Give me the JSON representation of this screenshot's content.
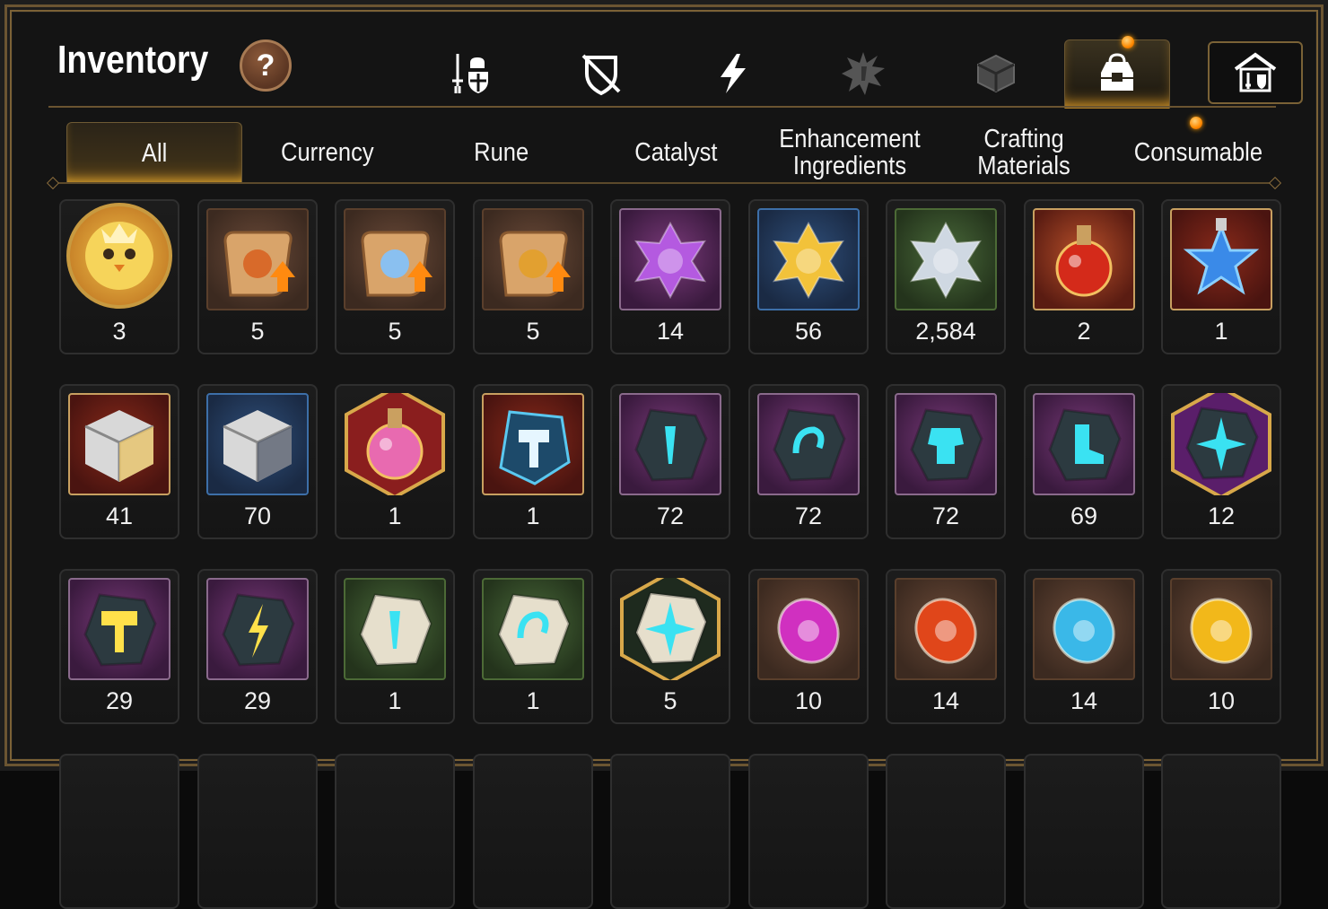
{
  "header": {
    "title": "Inventory",
    "help_label": "?"
  },
  "top_tabs": [
    {
      "name": "hero-gear-icon",
      "active": false
    },
    {
      "name": "shield-crossed-icon",
      "active": false
    },
    {
      "name": "lightning-icon",
      "active": false
    },
    {
      "name": "gem-splash-icon",
      "active": false
    },
    {
      "name": "cube-icon",
      "active": false
    },
    {
      "name": "bag-icon",
      "active": true
    }
  ],
  "category_tabs": [
    {
      "label": "All",
      "active": true
    },
    {
      "label": "Currency",
      "active": false
    },
    {
      "label": "Rune",
      "active": false
    },
    {
      "label": "Catalyst",
      "active": false
    },
    {
      "label": "Enhancement Ingredients",
      "active": false
    },
    {
      "label": "Crafting Materials",
      "active": false
    },
    {
      "label": "Consumable",
      "active": false
    }
  ],
  "items": [
    {
      "icon": "chick-coin-icon",
      "count": "3",
      "bg": "round"
    },
    {
      "icon": "scroll-dragon-upgrade-icon",
      "count": "5",
      "bg": "brown"
    },
    {
      "icon": "scroll-rainbow-cube-upgrade-icon",
      "count": "5",
      "bg": "brown"
    },
    {
      "icon": "scroll-gold-upgrade-icon",
      "count": "5",
      "bg": "brown"
    },
    {
      "icon": "purple-crystal-icon",
      "count": "14",
      "bg": "purple"
    },
    {
      "icon": "gold-crystal-icon",
      "count": "56",
      "bg": "blue"
    },
    {
      "icon": "silver-crystal-icon",
      "count": "2,584",
      "bg": "green"
    },
    {
      "icon": "red-potion-icon",
      "count": "2",
      "bg": "red"
    },
    {
      "icon": "star-potion-icon",
      "count": "1",
      "bg": "dkred"
    },
    {
      "icon": "gold-chest-icon",
      "count": "41",
      "bg": "dkred"
    },
    {
      "icon": "silver-chest-icon",
      "count": "70",
      "bg": "blue"
    },
    {
      "icon": "pink-potion-icon",
      "count": "1",
      "bg": "hex-red"
    },
    {
      "icon": "hammer-rune-blue-icon",
      "count": "1",
      "bg": "dkred"
    },
    {
      "icon": "sword-rune-stone-icon",
      "count": "72",
      "bg": "purple"
    },
    {
      "icon": "swirl-rune-stone-icon",
      "count": "72",
      "bg": "purple"
    },
    {
      "icon": "armor-rune-stone-icon",
      "count": "72",
      "bg": "purple"
    },
    {
      "icon": "boot-rune-stone-icon",
      "count": "69",
      "bg": "purple"
    },
    {
      "icon": "star-rune-stone-icon",
      "count": "12",
      "bg": "hex-purple"
    },
    {
      "icon": "hammer-rune-gold-icon",
      "count": "29",
      "bg": "purple"
    },
    {
      "icon": "bolt-rune-gold-icon",
      "count": "29",
      "bg": "purple"
    },
    {
      "icon": "sword-rune-light-icon",
      "count": "1",
      "bg": "green"
    },
    {
      "icon": "swirl-rune-light-icon",
      "count": "1",
      "bg": "green"
    },
    {
      "icon": "star-rune-light-icon",
      "count": "5",
      "bg": "hex-green"
    },
    {
      "icon": "moon-orb-icon",
      "count": "10",
      "bg": "brown"
    },
    {
      "icon": "fire-orb-icon",
      "count": "14",
      "bg": "brown"
    },
    {
      "icon": "ice-orb-icon",
      "count": "14",
      "bg": "brown"
    },
    {
      "icon": "sun-orb-icon",
      "count": "10",
      "bg": "brown"
    }
  ]
}
